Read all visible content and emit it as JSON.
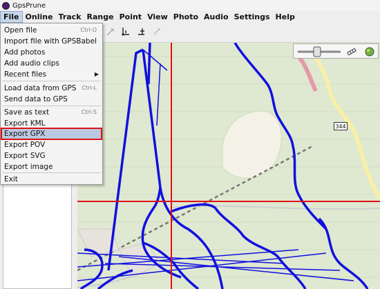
{
  "window": {
    "title": "GpsPrune"
  },
  "menubar": {
    "items": [
      "File",
      "Online",
      "Track",
      "Range",
      "Point",
      "View",
      "Photo",
      "Audio",
      "Settings",
      "Help"
    ]
  },
  "file_menu": {
    "items": [
      {
        "label": "Open file",
        "accel": "Ctrl-O"
      },
      {
        "label": "Import file with GPSBabel",
        "accel": ""
      },
      {
        "label": "Add photos",
        "accel": ""
      },
      {
        "label": "Add audio clips",
        "accel": ""
      },
      {
        "label": "Recent files",
        "accel": ""
      },
      {
        "label": "Load data from GPS",
        "accel": "Ctrl-L"
      },
      {
        "label": "Send data to GPS",
        "accel": ""
      },
      {
        "label": "Save as text",
        "accel": "Ctrl-S"
      },
      {
        "label": "Export KML",
        "accel": ""
      },
      {
        "label": "Export GPX",
        "accel": ""
      },
      {
        "label": "Export POV",
        "accel": ""
      },
      {
        "label": "Export SVG",
        "accel": ""
      },
      {
        "label": "Export image",
        "accel": ""
      },
      {
        "label": "Exit",
        "accel": ""
      }
    ],
    "selected": "Export GPX"
  },
  "map": {
    "route_badge": "344",
    "zoom_level": 0.45
  },
  "icons": {
    "toolbar": [
      "edit-point-icon",
      "connect-points-icon",
      "insert-point-icon",
      "delete-icon"
    ],
    "map_controls": [
      "zoom-slider-icon",
      "scale-ruler-icon",
      "globe-icon"
    ]
  },
  "colors": {
    "track": "#1010e0",
    "crosshair": "#e01010",
    "map_background": "#dfe8d0",
    "highlight_border": "#e01010",
    "menu_selection": "#b9c9e0"
  }
}
